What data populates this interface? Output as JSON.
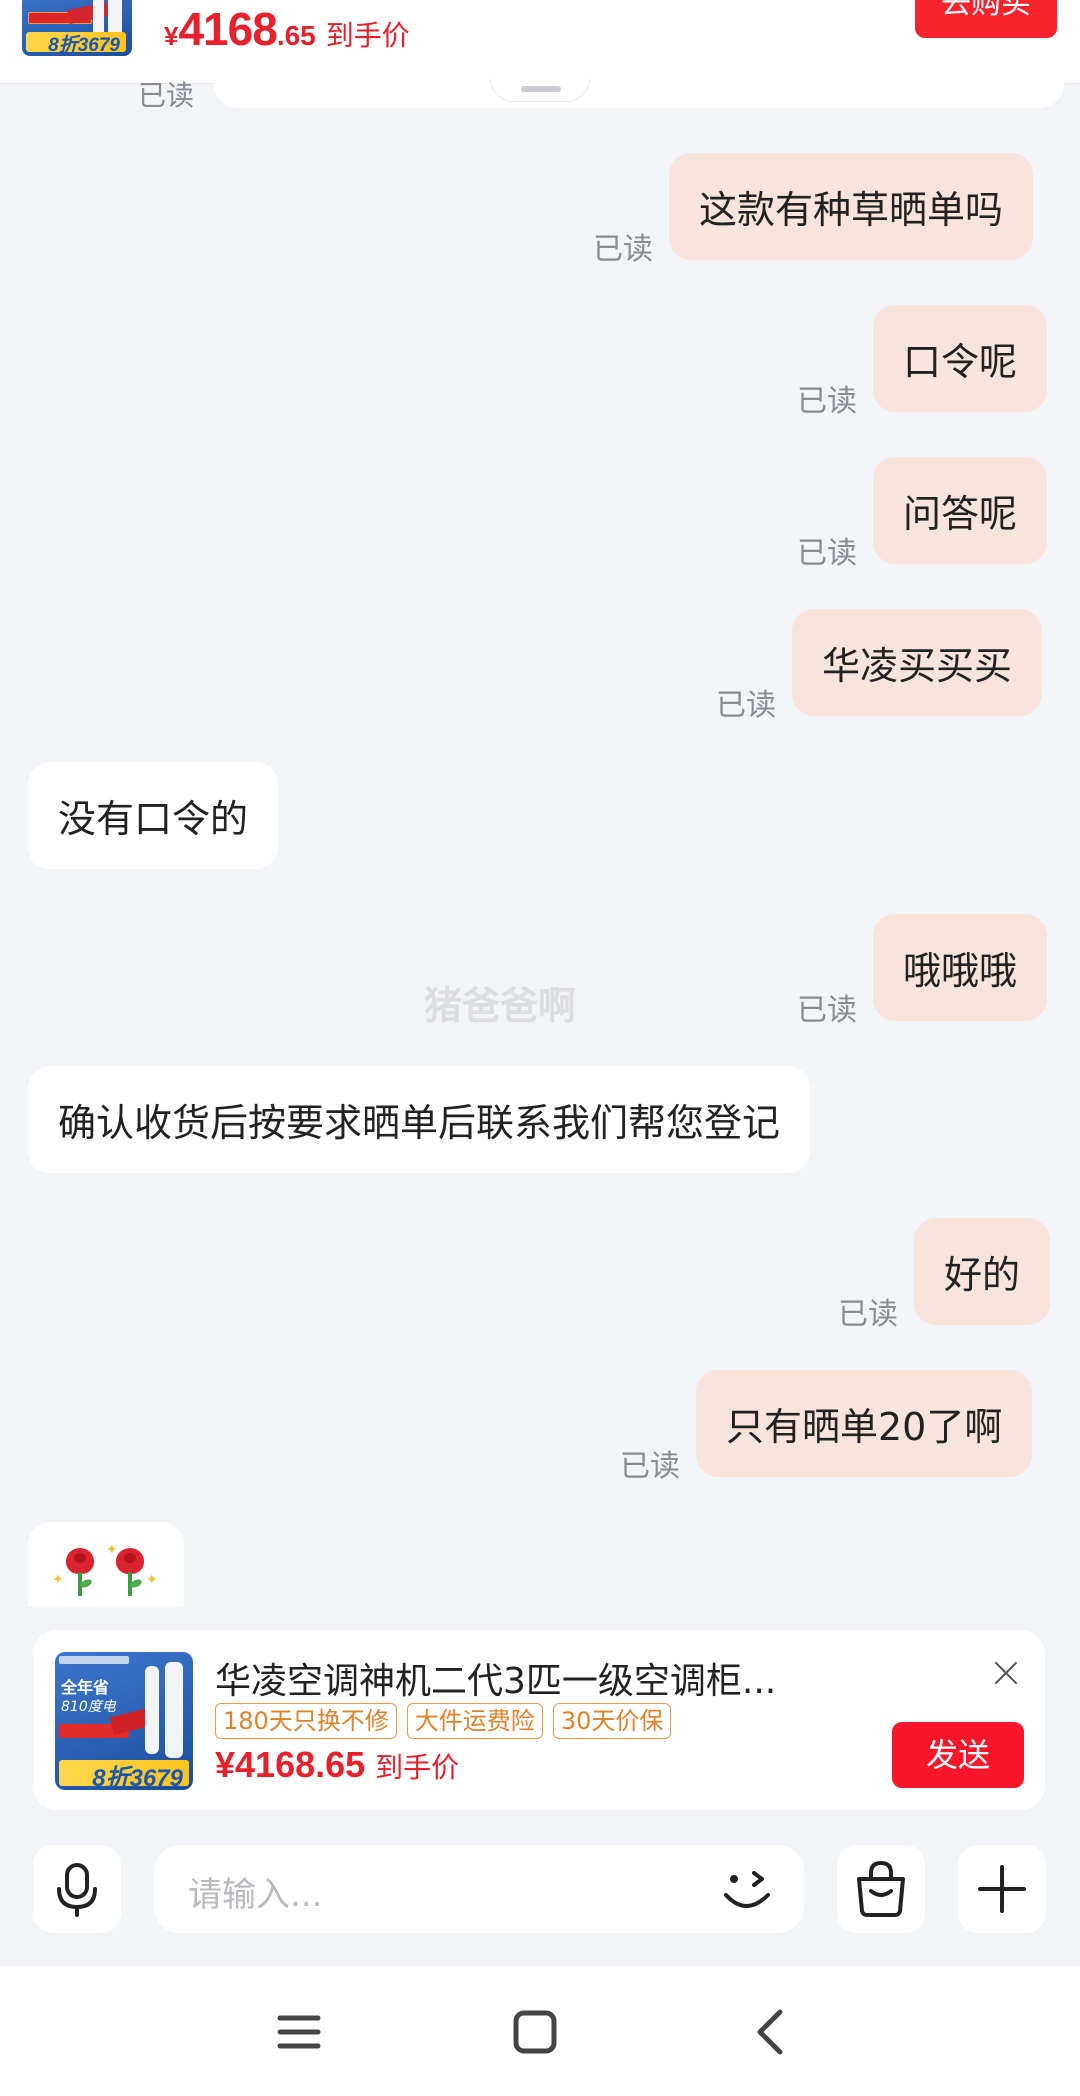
{
  "top_bar": {
    "price_currency": "¥",
    "price_int": "4168",
    "price_dec": ".65",
    "price_label": "到手价",
    "buy_button": "去购买",
    "thumb_price": "8折3679"
  },
  "cut_read": "已读",
  "messages": [
    {
      "side": "out",
      "text": "这款有种草晒单吗",
      "read": "已读"
    },
    {
      "side": "out",
      "text": "口令呢",
      "read": "已读"
    },
    {
      "side": "out",
      "text": "问答呢",
      "read": "已读"
    },
    {
      "side": "out",
      "text": "华凌买买买",
      "read": "已读"
    },
    {
      "side": "in",
      "text": "没有口令的"
    },
    {
      "side": "out",
      "text": "哦哦哦",
      "read": "已读"
    },
    {
      "side": "in",
      "text": "确认收货后按要求晒单后联系我们帮您登记"
    },
    {
      "side": "out",
      "text": "好的",
      "read": "已读"
    },
    {
      "side": "out",
      "text": "只有晒单20了啊",
      "read": "已读"
    }
  ],
  "watermark": "猪爸爸啊",
  "product_card": {
    "title": "华凌空调神机二代3匹一级空调柜...",
    "tags": [
      "180天只换不修",
      "大件运费险",
      "30天价保"
    ],
    "price": "¥4168.65",
    "price_label": "到手价",
    "send_button": "发送",
    "thumb_line1": "全年省",
    "thumb_line2": "810度电",
    "thumb_price": "8折3679"
  },
  "input": {
    "placeholder": "请输入..."
  },
  "icons": {
    "mic": "microphone-icon",
    "emoji": "wink-emoji-icon",
    "bag": "shopping-bag-icon",
    "plus": "plus-icon",
    "close": "close-icon",
    "nav_menu": "menu-icon",
    "nav_home": "home-icon",
    "nav_back": "back-icon"
  },
  "colors": {
    "accent_red": "#f6172a",
    "price_red": "#e8202b",
    "outgoing_bubble": "#f8e4dc",
    "tag_orange": "#e0822a"
  }
}
